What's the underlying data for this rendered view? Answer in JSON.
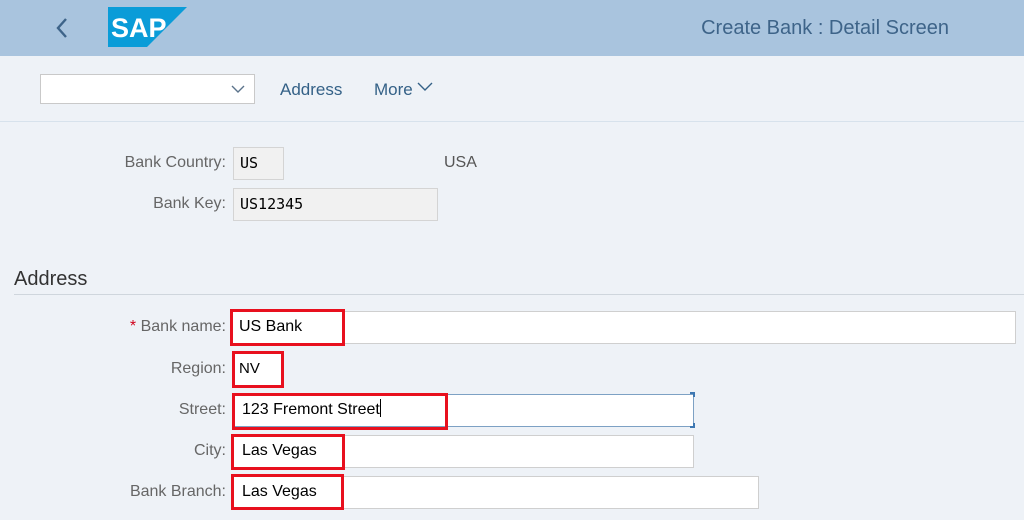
{
  "header": {
    "back_icon": "chevron-left-icon",
    "logo_text": "SAP",
    "logo_color": "#0a9cd8",
    "title": "Create Bank : Detail Screen",
    "background": "#a9c4de"
  },
  "toolbar": {
    "select_value": "",
    "select_icon": "chevron-down-icon",
    "address_label": "Address",
    "more_label": "More",
    "more_icon": "chevron-down-icon"
  },
  "bank_info": {
    "country_label": "Bank Country:",
    "country_value": "US",
    "country_name": "USA",
    "key_label": "Bank Key:",
    "key_value": "US12345"
  },
  "address": {
    "section_title": "Address",
    "fields": [
      {
        "label": "Bank name:",
        "required": true,
        "required_mark": "*",
        "value": "US Bank"
      },
      {
        "label": "Region:",
        "required": false,
        "value": "NV"
      },
      {
        "label": "Street:",
        "required": false,
        "value": "123 Fremont Street",
        "focused": true
      },
      {
        "label": "City:",
        "required": false,
        "value": "Las Vegas"
      },
      {
        "label": "Bank Branch:",
        "required": false,
        "value": "Las Vegas"
      }
    ]
  },
  "highlight_color": "#e8101e"
}
